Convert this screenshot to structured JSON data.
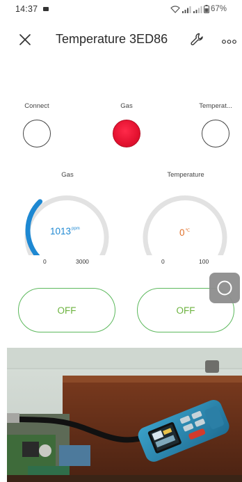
{
  "status_bar": {
    "time": "14:37",
    "battery": "67%"
  },
  "header": {
    "title": "Temperature 3ED86",
    "icons": [
      "close-icon",
      "wrench-icon",
      "more-icon"
    ]
  },
  "indicators": [
    {
      "label": "Connect",
      "state": "off"
    },
    {
      "label": "Gas",
      "state": "on",
      "color": "#e3112f"
    },
    {
      "label": "Temperat...",
      "state": "off"
    }
  ],
  "gauges": [
    {
      "label": "Gas",
      "value": "1013",
      "numeric_value": 1013,
      "unit": "ppm",
      "min": "0",
      "max": "3000",
      "color": "#1e88d2",
      "fraction": 0.338
    },
    {
      "label": "Temperature",
      "value": "0",
      "numeric_value": 0,
      "unit": "℃",
      "min": "0",
      "max": "100",
      "color": "#e0702a",
      "fraction": 0.0
    }
  ],
  "switches": [
    {
      "label": "OFF"
    },
    {
      "label": "OFF"
    }
  ],
  "colors": {
    "accent_green": "#6cb33f",
    "track_gray": "#e2e2e2",
    "gas_blue": "#1e88d2",
    "temp_orange": "#e0702a",
    "alarm_red": "#e3112f"
  }
}
